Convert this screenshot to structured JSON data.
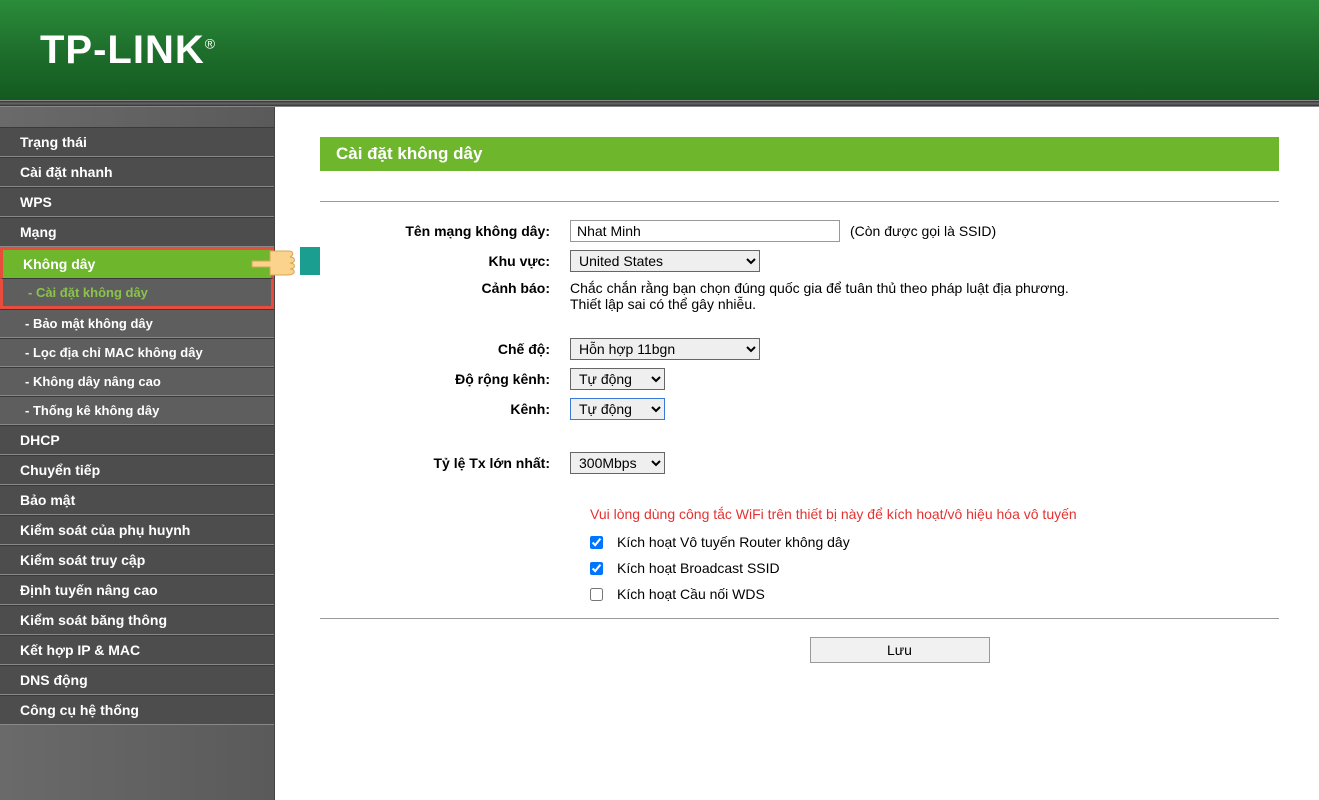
{
  "brand": "TP-LINK",
  "sidebar": {
    "items": [
      "Trạng thái",
      "Cài đặt nhanh",
      "WPS",
      "Mạng",
      "Không dây",
      "DHCP",
      "Chuyển tiếp",
      "Bảo mật",
      "Kiểm soát của phụ huynh",
      "Kiểm soát truy cập",
      "Định tuyến nâng cao",
      "Kiểm soát băng thông",
      "Kết hợp IP & MAC",
      "DNS động",
      "Công cụ hệ thống"
    ],
    "wireless_sub": [
      "- Cài đặt không dây",
      "- Bảo mật không dây",
      "- Lọc địa chỉ MAC không dây",
      "- Không dây nâng cao",
      "- Thống kê không dây"
    ]
  },
  "page": {
    "title": "Cài đặt không dây",
    "labels": {
      "ssid": "Tên mạng không dây:",
      "region": "Khu vực:",
      "warning": "Cảnh báo:",
      "mode": "Chế độ:",
      "channel_width": "Độ rộng kênh:",
      "channel": "Kênh:",
      "max_tx": "Tỷ lệ Tx lớn nhất:"
    },
    "values": {
      "ssid": "Nhat Minh",
      "ssid_hint": "(Còn được gọi là SSID)",
      "region": "United States",
      "warning_text_l1": "Chắc chắn rằng bạn chọn đúng quốc gia để tuân thủ theo pháp luật địa phương.",
      "warning_text_l2": "Thiết lập sai có thể gây nhiễu.",
      "mode": "Hỗn hợp 11bgn",
      "channel_width": "Tự động",
      "channel": "Tự động",
      "max_tx": "300Mbps"
    },
    "notice": "Vui lòng dùng công tắc WiFi trên thiết bị này để kích hoạt/vô hiệu hóa vô tuyến",
    "checkboxes": {
      "enable_radio": {
        "label": "Kích hoạt Vô tuyến Router không dây",
        "checked": true
      },
      "enable_broadcast": {
        "label": "Kích hoạt Broadcast SSID",
        "checked": true
      },
      "enable_wds": {
        "label": "Kích hoạt Cầu nối WDS",
        "checked": false
      }
    },
    "save_label": "Lưu"
  }
}
